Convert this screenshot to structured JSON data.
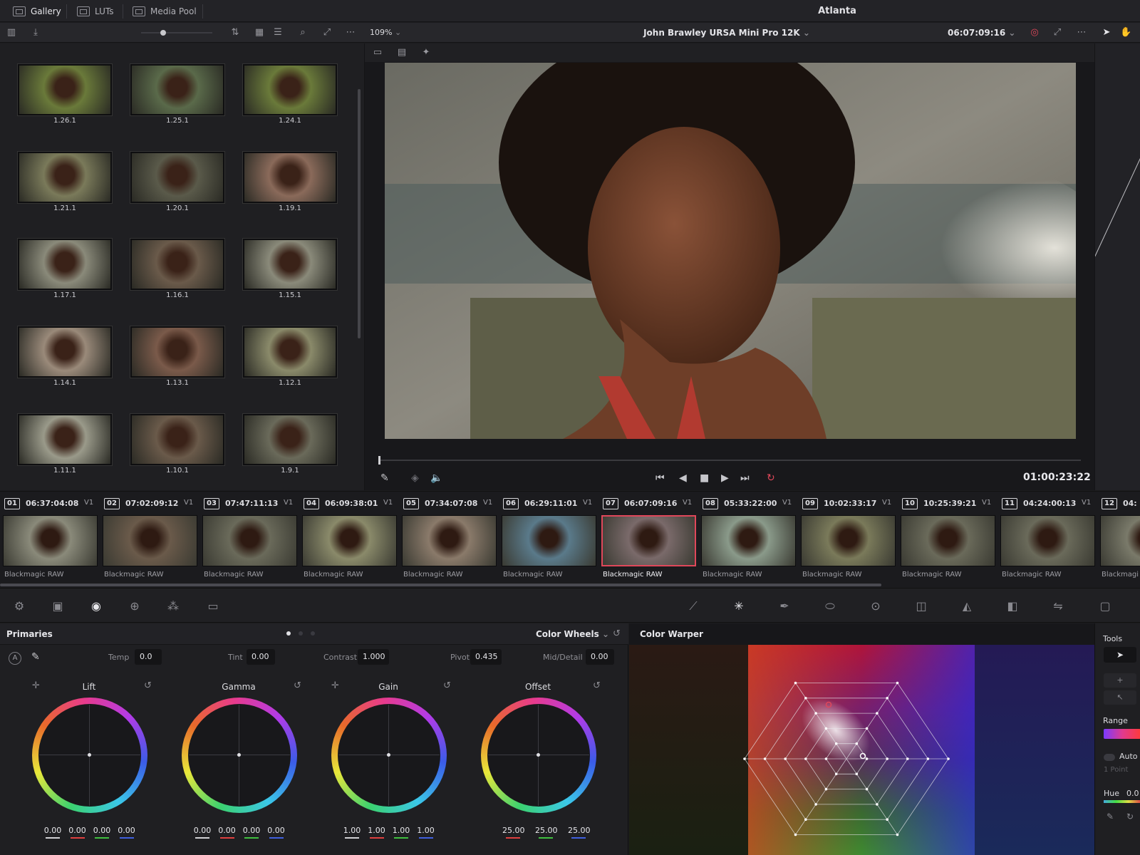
{
  "app": {
    "project_title": "Atlanta"
  },
  "top_tabs": [
    {
      "label": "Gallery",
      "active": true
    },
    {
      "label": "LUTs",
      "active": false
    },
    {
      "label": "Media Pool",
      "active": false
    }
  ],
  "viewer": {
    "zoom": "109%",
    "clip_name": "John Brawley URSA Mini Pro 12K",
    "source_timecode": "06:07:09:16",
    "record_timecode": "01:00:23:22"
  },
  "gallery": {
    "stills": [
      "1.26.1",
      "1.25.1",
      "1.24.1",
      "1.21.1",
      "1.20.1",
      "1.19.1",
      "1.17.1",
      "1.16.1",
      "1.15.1",
      "1.14.1",
      "1.13.1",
      "1.12.1",
      "1.11.1",
      "1.10.1",
      "1.9.1"
    ]
  },
  "timeline": {
    "clips": [
      {
        "num": "01",
        "tc": "06:37:04:08",
        "track": "V1",
        "codec": "Blackmagic RAW",
        "selected": false
      },
      {
        "num": "02",
        "tc": "07:02:09:12",
        "track": "V1",
        "codec": "Blackmagic RAW",
        "selected": false
      },
      {
        "num": "03",
        "tc": "07:47:11:13",
        "track": "V1",
        "codec": "Blackmagic RAW",
        "selected": false
      },
      {
        "num": "04",
        "tc": "06:09:38:01",
        "track": "V1",
        "codec": "Blackmagic RAW",
        "selected": false
      },
      {
        "num": "05",
        "tc": "07:34:07:08",
        "track": "V1",
        "codec": "Blackmagic RAW",
        "selected": false
      },
      {
        "num": "06",
        "tc": "06:29:11:01",
        "track": "V1",
        "codec": "Blackmagic RAW",
        "selected": false
      },
      {
        "num": "07",
        "tc": "06:07:09:16",
        "track": "V1",
        "codec": "Blackmagic RAW",
        "selected": true
      },
      {
        "num": "08",
        "tc": "05:33:22:00",
        "track": "V1",
        "codec": "Blackmagic RAW",
        "selected": false
      },
      {
        "num": "09",
        "tc": "10:02:33:17",
        "track": "V1",
        "codec": "Blackmagic RAW",
        "selected": false
      },
      {
        "num": "10",
        "tc": "10:25:39:21",
        "track": "V1",
        "codec": "Blackmagic RAW",
        "selected": false
      },
      {
        "num": "11",
        "tc": "04:24:00:13",
        "track": "V1",
        "codec": "Blackmagic RAW",
        "selected": false
      },
      {
        "num": "12",
        "tc": "04:",
        "track": "",
        "codec": "Blackmagi",
        "selected": false
      }
    ]
  },
  "primaries": {
    "title": "Primaries",
    "mode": "Color Wheels",
    "params": {
      "temp_label": "Temp",
      "temp": "0.0",
      "tint_label": "Tint",
      "tint": "0.00",
      "contrast_label": "Contrast",
      "contrast": "1.000",
      "pivot_label": "Pivot",
      "pivot": "0.435",
      "middetail_label": "Mid/Detail",
      "middetail": "0.00"
    },
    "wheels": [
      {
        "name": "Lift",
        "values": [
          "0.00",
          "0.00",
          "0.00",
          "0.00"
        ]
      },
      {
        "name": "Gamma",
        "values": [
          "0.00",
          "0.00",
          "0.00",
          "0.00"
        ]
      },
      {
        "name": "Gain",
        "values": [
          "1.00",
          "1.00",
          "1.00",
          "1.00"
        ]
      },
      {
        "name": "Offset",
        "values": [
          "25.00",
          "25.00",
          "25.00"
        ]
      }
    ]
  },
  "warper": {
    "title": "Color Warper"
  },
  "tools": {
    "title": "Tools",
    "range_label": "Range",
    "auto_label": "Auto",
    "point_label": "1 Point",
    "hue_label": "Hue",
    "hue_value": "0.0"
  },
  "colors": {
    "selected_border": "#e0475a",
    "loop_icon": "#e0475a",
    "accent": "#d7d7db"
  }
}
